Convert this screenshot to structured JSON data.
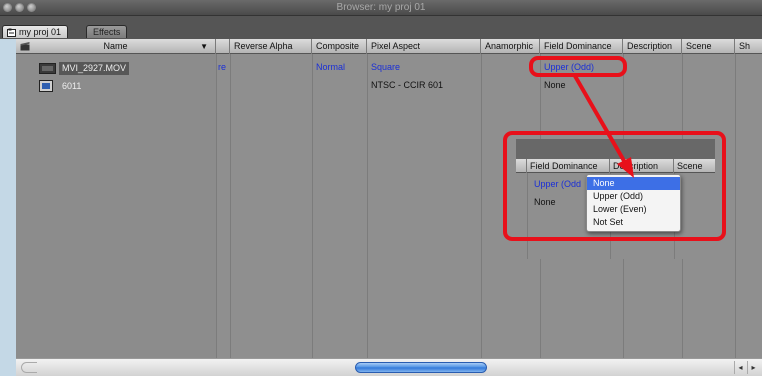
{
  "window": {
    "title": "Browser: my proj 01"
  },
  "tabs": [
    {
      "label": "my proj 01",
      "active": true
    },
    {
      "label": "Effects",
      "active": false
    }
  ],
  "columns": [
    "Name",
    "Reverse Alpha",
    "Composite",
    "Pixel Aspect",
    "Anamorphic",
    "Field Dominance",
    "Description",
    "Scene",
    "Sh"
  ],
  "rows": [
    {
      "name": "MVI_2927.MOV",
      "reverse_alpha": "re",
      "composite": "Normal",
      "pixel_aspect": "Square",
      "anamorphic": "",
      "field_dominance": "Upper (Odd)",
      "description": "",
      "scene": ""
    },
    {
      "name": "6011",
      "reverse_alpha": "",
      "composite": "",
      "pixel_aspect": "NTSC - CCIR 601",
      "anamorphic": "",
      "field_dominance": "None",
      "description": "",
      "scene": ""
    }
  ],
  "inset": {
    "columns": [
      "Field Dominance",
      "Description",
      "Scene"
    ],
    "values": [
      "Upper (Odd",
      "None"
    ]
  },
  "dropdown": {
    "options": [
      "None",
      "Upper (Odd)",
      "Lower (Even)",
      "Not Set"
    ],
    "highlighted": "None"
  },
  "colors": {
    "annotation": "#e8101a",
    "link_blue": "#1a2fd6",
    "highlight": "#3d6fe6",
    "background": "#c4d8e6"
  },
  "scrollbar": {
    "right_glyphs": [
      "◂",
      "▸"
    ]
  }
}
